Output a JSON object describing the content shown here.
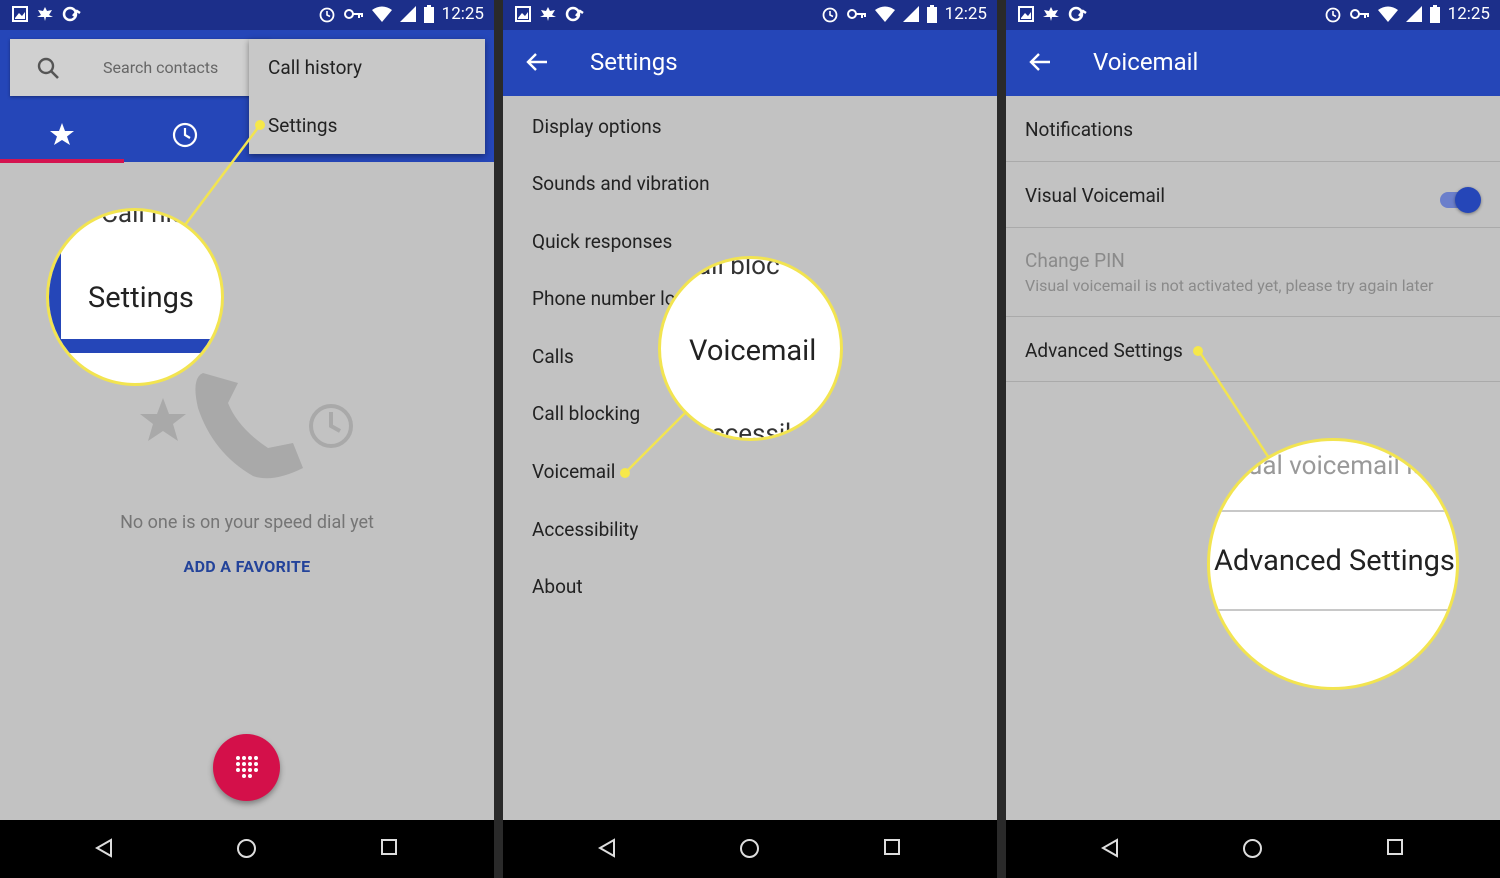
{
  "status_bar": {
    "time": "12:25"
  },
  "panel1": {
    "search_placeholder": "Search contacts",
    "menu": {
      "items": [
        "Call history",
        "Settings"
      ]
    },
    "empty_message": "No one is on your speed dial yet",
    "add_favorite": "ADD A FAVORITE",
    "magnifier": {
      "top_text": "Call his",
      "label": "Settings"
    }
  },
  "panel2": {
    "title": "Settings",
    "items": [
      "Display options",
      "Sounds and vibration",
      "Quick responses",
      "Phone number lo",
      "Calls",
      "Call blocking",
      "Voicemail",
      "Accessibility",
      "About"
    ],
    "magnifier": {
      "top_text": "all bloc",
      "label": "Voicemail",
      "bottom_text": "ccessib"
    }
  },
  "panel3": {
    "title": "Voicemail",
    "notifications": "Notifications",
    "visual_voicemail": "Visual Voicemail",
    "visual_voicemail_on": true,
    "change_pin": "Change PIN",
    "change_pin_sub": "Visual voicemail is not activated yet, please try again later",
    "advanced_settings": "Advanced Settings",
    "magnifier": {
      "top_text": "ual voicemail is",
      "label": "Advanced Settings"
    }
  },
  "colors": {
    "status_bar": "#1c2f8a",
    "app_bar": "#2546b8",
    "fab": "#d4104a",
    "highlight": "#f2e450"
  }
}
